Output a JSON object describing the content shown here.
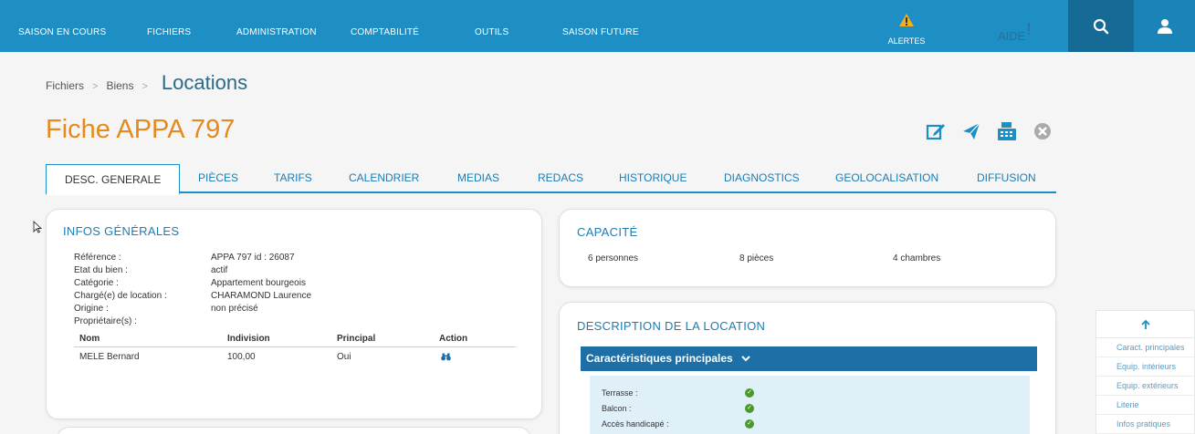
{
  "nav": {
    "items": [
      "SAISON EN COURS",
      "FICHIERS",
      "ADMINISTRATION",
      "COMPTABILITÉ",
      "OUTILS",
      "SAISON FUTURE"
    ],
    "alerts_label": "ALERTES",
    "alert_icon": "warning-icon",
    "aide_label": "AIDE",
    "aide_mark": "!",
    "search_icon": "search-icon",
    "user_icon": "user-icon"
  },
  "breadcrumb": {
    "items": [
      "Fichiers",
      "Biens"
    ],
    "separator": ">",
    "current": "Locations"
  },
  "title": "Fiche APPA 797",
  "actions": [
    "edit-icon",
    "send-icon",
    "fax-icon",
    "close-icon"
  ],
  "tabs": [
    "DESC. GENERALE",
    "PIÈCES",
    "TARIFS",
    "CALENDRIER",
    "MEDIAS",
    "REDACS",
    "HISTORIQUE",
    "DIAGNOSTICS",
    "GEOLOCALISATION",
    "DIFFUSION"
  ],
  "infos": {
    "title": "INFOS GÉNÉRALES",
    "rows": [
      {
        "label": "Référence :",
        "value": "APPA 797   id : 26087"
      },
      {
        "label": "Etat du bien :",
        "value": "actif"
      },
      {
        "label": "Catégorie :",
        "value": "Appartement bourgeois"
      },
      {
        "label": "Chargé(e) de location :",
        "value": "CHARAMOND Laurence"
      },
      {
        "label": "Origine :",
        "value": "non précisé"
      },
      {
        "label": "Propriétaire(s) :",
        "value": ""
      }
    ],
    "owner_headers": [
      "Nom",
      "Indivision",
      "Principal",
      "Action"
    ],
    "owner_row": {
      "nom": "MELE Bernard",
      "indivision": "100,00",
      "principal": "Oui",
      "action_icon": "binoculars-icon"
    }
  },
  "capacite": {
    "title": "CAPACITÉ",
    "items": [
      "6 personnes",
      "8 pièces",
      "4 chambres"
    ]
  },
  "description": {
    "title": "DESCRIPTION DE LA LOCATION",
    "section": "Caractéristiques principales",
    "features": [
      "Terrasse :",
      "Balcon :",
      "Accès handicapé :"
    ]
  },
  "side_nav": {
    "up_icon": "arrow-up-icon",
    "items": [
      "Caract. principales",
      "Equip. intérieurs",
      "Equip. extérieurs",
      "Literie",
      "Infos pratiques"
    ]
  },
  "colors": {
    "nav_bg": "#1d8fc4",
    "title_orange": "#e58a1c",
    "link_blue": "#1b7db3",
    "section_bar": "#1d6fa6"
  }
}
